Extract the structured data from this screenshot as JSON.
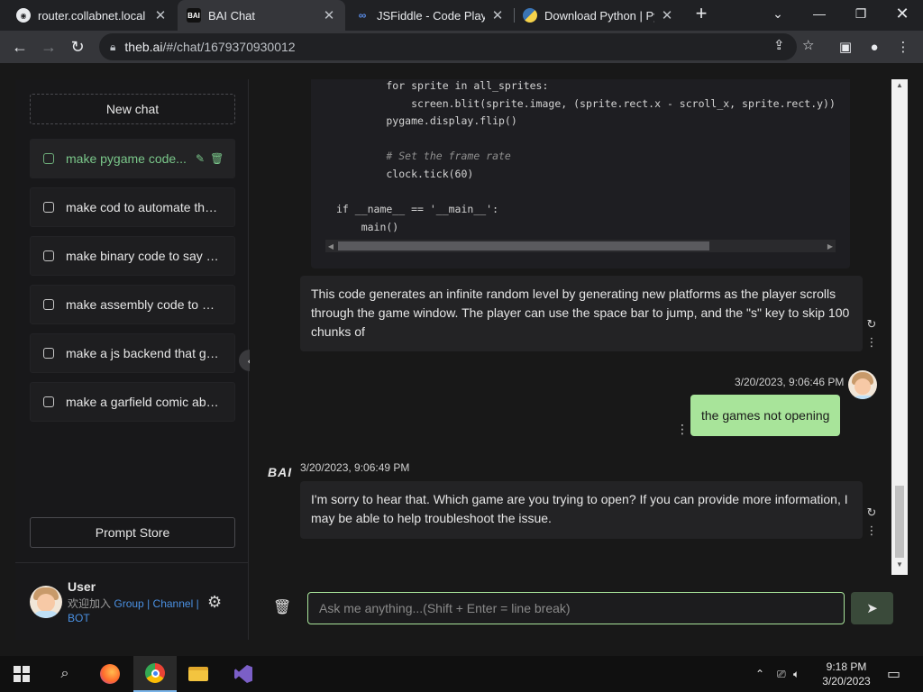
{
  "browser": {
    "tabs": [
      {
        "title": "router.collabnet.local -",
        "favicon": "globe-icon"
      },
      {
        "title": "BAI Chat",
        "favicon": "bai-icon"
      },
      {
        "title": "JSFiddle - Code Playgro",
        "favicon": "jsfiddle-icon"
      },
      {
        "title": "Download Python | Pyt",
        "favicon": "python-icon"
      }
    ],
    "url_host": "theb.ai",
    "url_path": "/#/chat/1679370930012"
  },
  "sidebar": {
    "new_chat": "New chat",
    "chats": [
      {
        "label": "make pygame code..."
      },
      {
        "label": "make cod to automate the..."
      },
      {
        "label": "make binary code to say h..."
      },
      {
        "label": "make assembly code to ge..."
      },
      {
        "label": "make a js backend that ge..."
      },
      {
        "label": "make a garfield comic abo..."
      }
    ],
    "prompt_store": "Prompt Store",
    "user": {
      "name": "User",
      "join_text": "欢迎加入",
      "group": "Group",
      "sep1": "|",
      "channel": "Channel",
      "sep2": "|",
      "bot": "BOT"
    }
  },
  "code": {
    "lines": [
      "        for sprite in all_sprites:",
      "            screen.blit(sprite.image, (sprite.rect.x - scroll_x, sprite.rect.y))",
      "        pygame.display.flip()",
      "",
      "        # Set the frame rate",
      "        clock.tick(60)",
      "",
      "if __name__ == '__main__':",
      "    main()"
    ]
  },
  "messages": {
    "bot1": "This code generates an infinite random level by generating new platforms as the player scrolls through the game window. The player can use the space bar to jump, and the \"s\" key to skip 100 chunks of",
    "user_time": "3/20/2023, 9:06:46 PM",
    "user_text": "the games not opening",
    "bot_logo": "BAI",
    "bot2_time": "3/20/2023, 9:06:49 PM",
    "bot2": "I'm sorry to hear that. Which game are you trying to open? If you can provide more information, I may be able to help troubleshoot the issue."
  },
  "input": {
    "placeholder": "Ask me anything...(Shift + Enter = line break)"
  },
  "taskbar": {
    "time": "9:18 PM",
    "date": "3/20/2023"
  },
  "colors": {
    "accent": "#a8e49a",
    "active_chat": "#7ac78a",
    "link": "#4a90e2"
  }
}
